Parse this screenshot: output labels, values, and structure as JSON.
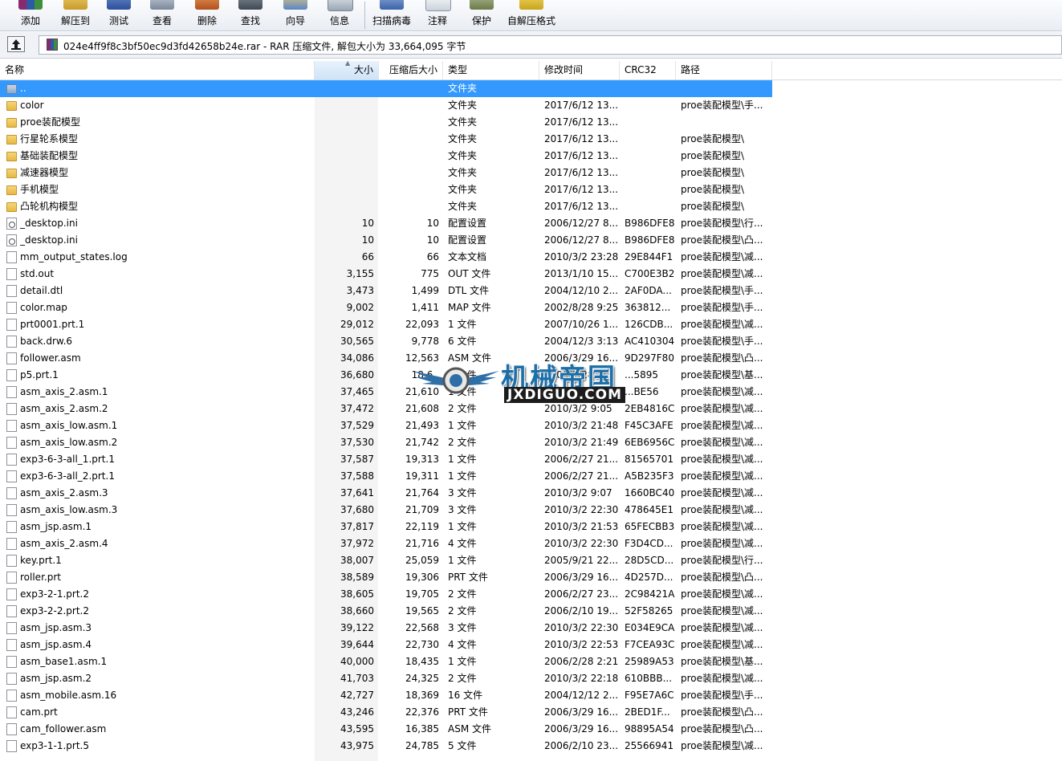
{
  "toolbar": {
    "buttons": [
      {
        "label": "添加"
      },
      {
        "label": "解压到"
      },
      {
        "label": "测试"
      },
      {
        "label": "查看"
      },
      {
        "label": "删除"
      },
      {
        "label": "查找"
      },
      {
        "label": "向导"
      },
      {
        "label": "信息"
      },
      {
        "label": "扫描病毒"
      },
      {
        "label": "注释"
      },
      {
        "label": "保护"
      },
      {
        "label": "自解压格式"
      }
    ]
  },
  "address": {
    "text": "024e4ff9f8c3bf50ec9d3fd42658b24e.rar - RAR 压缩文件, 解包大小为 33,664,095 字节"
  },
  "columns": {
    "name": "名称",
    "size": "大小",
    "packed": "压缩后大小",
    "type": "类型",
    "modified": "修改时间",
    "crc": "CRC32",
    "path": "路径"
  },
  "rows": [
    {
      "icon": "updir",
      "name": "..",
      "size": "",
      "packed": "",
      "type": "文件夹",
      "modified": "",
      "crc": "",
      "path": ""
    },
    {
      "icon": "folder",
      "name": "color",
      "size": "",
      "packed": "",
      "type": "文件夹",
      "modified": "2017/6/12 13...",
      "crc": "",
      "path": "proe装配模型\\手..."
    },
    {
      "icon": "folder",
      "name": "proe装配模型",
      "size": "",
      "packed": "",
      "type": "文件夹",
      "modified": "2017/6/12 13...",
      "crc": "",
      "path": ""
    },
    {
      "icon": "folder",
      "name": "行星轮系模型",
      "size": "",
      "packed": "",
      "type": "文件夹",
      "modified": "2017/6/12 13...",
      "crc": "",
      "path": "proe装配模型\\"
    },
    {
      "icon": "folder",
      "name": "基础装配模型",
      "size": "",
      "packed": "",
      "type": "文件夹",
      "modified": "2017/6/12 13...",
      "crc": "",
      "path": "proe装配模型\\"
    },
    {
      "icon": "folder",
      "name": "减速器模型",
      "size": "",
      "packed": "",
      "type": "文件夹",
      "modified": "2017/6/12 13...",
      "crc": "",
      "path": "proe装配模型\\"
    },
    {
      "icon": "folder",
      "name": "手机模型",
      "size": "",
      "packed": "",
      "type": "文件夹",
      "modified": "2017/6/12 13...",
      "crc": "",
      "path": "proe装配模型\\"
    },
    {
      "icon": "folder",
      "name": "凸轮机构模型",
      "size": "",
      "packed": "",
      "type": "文件夹",
      "modified": "2017/6/12 13...",
      "crc": "",
      "path": "proe装配模型\\"
    },
    {
      "icon": "ini",
      "name": "_desktop.ini",
      "size": "10",
      "packed": "10",
      "type": "配置设置",
      "modified": "2006/12/27 8...",
      "crc": "B986DFE8",
      "path": "proe装配模型\\行..."
    },
    {
      "icon": "ini",
      "name": "_desktop.ini",
      "size": "10",
      "packed": "10",
      "type": "配置设置",
      "modified": "2006/12/27 8...",
      "crc": "B986DFE8",
      "path": "proe装配模型\\凸..."
    },
    {
      "icon": "file",
      "name": "mm_output_states.log",
      "size": "66",
      "packed": "66",
      "type": "文本文档",
      "modified": "2010/3/2 23:28",
      "crc": "29E844F1",
      "path": "proe装配模型\\减..."
    },
    {
      "icon": "file",
      "name": "std.out",
      "size": "3,155",
      "packed": "775",
      "type": "OUT 文件",
      "modified": "2013/1/10 15...",
      "crc": "C700E3B2",
      "path": "proe装配模型\\减..."
    },
    {
      "icon": "file",
      "name": "detail.dtl",
      "size": "3,473",
      "packed": "1,499",
      "type": "DTL 文件",
      "modified": "2004/12/10 2...",
      "crc": "2AF0DA...",
      "path": "proe装配模型\\手..."
    },
    {
      "icon": "file",
      "name": "color.map",
      "size": "9,002",
      "packed": "1,411",
      "type": "MAP 文件",
      "modified": "2002/8/28 9:25",
      "crc": "363812...",
      "path": "proe装配模型\\手..."
    },
    {
      "icon": "file",
      "name": "prt0001.prt.1",
      "size": "29,012",
      "packed": "22,093",
      "type": "1 文件",
      "modified": "2007/10/26 1...",
      "crc": "126CDB...",
      "path": "proe装配模型\\减..."
    },
    {
      "icon": "file",
      "name": "back.drw.6",
      "size": "30,565",
      "packed": "9,778",
      "type": "6 文件",
      "modified": "2004/12/3 3:13",
      "crc": "AC410304",
      "path": "proe装配模型\\手..."
    },
    {
      "icon": "file",
      "name": "follower.asm",
      "size": "34,086",
      "packed": "12,563",
      "type": "ASM 文件",
      "modified": "2006/3/29 16...",
      "crc": "9D297F80",
      "path": "proe装配模型\\凸..."
    },
    {
      "icon": "file",
      "name": "p5.prt.1",
      "size": "36,680",
      "packed": "18,6..",
      "type": "1 文件",
      "modified": "2006/2/28 2:..",
      "crc": "...5895",
      "path": "proe装配模型\\基..."
    },
    {
      "icon": "file",
      "name": "asm_axis_2.asm.1",
      "size": "37,465",
      "packed": "21,610",
      "type": "1 文件",
      "modified": "2010/3/2 21:..",
      "crc": "...BE56",
      "path": "proe装配模型\\减..."
    },
    {
      "icon": "file",
      "name": "asm_axis_2.asm.2",
      "size": "37,472",
      "packed": "21,608",
      "type": "2 文件",
      "modified": "2010/3/2 9:05",
      "crc": "2EB4816C",
      "path": "proe装配模型\\减..."
    },
    {
      "icon": "file",
      "name": "asm_axis_low.asm.1",
      "size": "37,529",
      "packed": "21,493",
      "type": "1 文件",
      "modified": "2010/3/2 21:48",
      "crc": "F45C3AFE",
      "path": "proe装配模型\\减..."
    },
    {
      "icon": "file",
      "name": "asm_axis_low.asm.2",
      "size": "37,530",
      "packed": "21,742",
      "type": "2 文件",
      "modified": "2010/3/2 21:49",
      "crc": "6EB6956C",
      "path": "proe装配模型\\减..."
    },
    {
      "icon": "file",
      "name": "exp3-6-3-all_1.prt.1",
      "size": "37,587",
      "packed": "19,313",
      "type": "1 文件",
      "modified": "2006/2/27 21...",
      "crc": "81565701",
      "path": "proe装配模型\\减..."
    },
    {
      "icon": "file",
      "name": "exp3-6-3-all_2.prt.1",
      "size": "37,588",
      "packed": "19,311",
      "type": "1 文件",
      "modified": "2006/2/27 21...",
      "crc": "A5B235F3",
      "path": "proe装配模型\\减..."
    },
    {
      "icon": "file",
      "name": "asm_axis_2.asm.3",
      "size": "37,641",
      "packed": "21,764",
      "type": "3 文件",
      "modified": "2010/3/2 9:07",
      "crc": "1660BC40",
      "path": "proe装配模型\\减..."
    },
    {
      "icon": "file",
      "name": "asm_axis_low.asm.3",
      "size": "37,680",
      "packed": "21,709",
      "type": "3 文件",
      "modified": "2010/3/2 22:30",
      "crc": "478645E1",
      "path": "proe装配模型\\减..."
    },
    {
      "icon": "file",
      "name": "asm_jsp.asm.1",
      "size": "37,817",
      "packed": "22,119",
      "type": "1 文件",
      "modified": "2010/3/2 21:53",
      "crc": "65FECBB3",
      "path": "proe装配模型\\减..."
    },
    {
      "icon": "file",
      "name": "asm_axis_2.asm.4",
      "size": "37,972",
      "packed": "21,716",
      "type": "4 文件",
      "modified": "2010/3/2 22:30",
      "crc": "F3D4CD...",
      "path": "proe装配模型\\减..."
    },
    {
      "icon": "file",
      "name": "key.prt.1",
      "size": "38,007",
      "packed": "25,059",
      "type": "1 文件",
      "modified": "2005/9/21 22...",
      "crc": "28D5CD...",
      "path": "proe装配模型\\行..."
    },
    {
      "icon": "file",
      "name": "roller.prt",
      "size": "38,589",
      "packed": "19,306",
      "type": "PRT 文件",
      "modified": "2006/3/29 16...",
      "crc": "4D257D...",
      "path": "proe装配模型\\凸..."
    },
    {
      "icon": "file",
      "name": "exp3-2-1.prt.2",
      "size": "38,605",
      "packed": "19,705",
      "type": "2 文件",
      "modified": "2006/2/27 23...",
      "crc": "2C98421A",
      "path": "proe装配模型\\减..."
    },
    {
      "icon": "file",
      "name": "exp3-2-2.prt.2",
      "size": "38,660",
      "packed": "19,565",
      "type": "2 文件",
      "modified": "2006/2/10 19...",
      "crc": "52F58265",
      "path": "proe装配模型\\减..."
    },
    {
      "icon": "file",
      "name": "asm_jsp.asm.3",
      "size": "39,122",
      "packed": "22,568",
      "type": "3 文件",
      "modified": "2010/3/2 22:30",
      "crc": "E034E9CA",
      "path": "proe装配模型\\减..."
    },
    {
      "icon": "file",
      "name": "asm_jsp.asm.4",
      "size": "39,644",
      "packed": "22,730",
      "type": "4 文件",
      "modified": "2010/3/2 22:53",
      "crc": "F7CEA93C",
      "path": "proe装配模型\\减..."
    },
    {
      "icon": "file",
      "name": "asm_base1.asm.1",
      "size": "40,000",
      "packed": "18,435",
      "type": "1 文件",
      "modified": "2006/2/28 2:21",
      "crc": "25989A53",
      "path": "proe装配模型\\基..."
    },
    {
      "icon": "file",
      "name": "asm_jsp.asm.2",
      "size": "41,703",
      "packed": "24,325",
      "type": "2 文件",
      "modified": "2010/3/2 22:18",
      "crc": "610BBB...",
      "path": "proe装配模型\\减..."
    },
    {
      "icon": "file",
      "name": "asm_mobile.asm.16",
      "size": "42,727",
      "packed": "18,369",
      "type": "16 文件",
      "modified": "2004/12/12 2...",
      "crc": "F95E7A6C",
      "path": "proe装配模型\\手..."
    },
    {
      "icon": "file",
      "name": "cam.prt",
      "size": "43,246",
      "packed": "22,376",
      "type": "PRT 文件",
      "modified": "2006/3/29 16...",
      "crc": "2BED1F...",
      "path": "proe装配模型\\凸..."
    },
    {
      "icon": "file",
      "name": "cam_follower.asm",
      "size": "43,595",
      "packed": "16,385",
      "type": "ASM 文件",
      "modified": "2006/3/29 16...",
      "crc": "98895A54",
      "path": "proe装配模型\\凸..."
    },
    {
      "icon": "file",
      "name": "exp3-1-1.prt.5",
      "size": "43,975",
      "packed": "24,785",
      "type": "5 文件",
      "modified": "2006/2/10 23...",
      "crc": "25566941",
      "path": "proe装配模型\\减..."
    }
  ],
  "watermark": {
    "title": "机械帝国",
    "subtitle": "JXDIGUO.COM"
  }
}
